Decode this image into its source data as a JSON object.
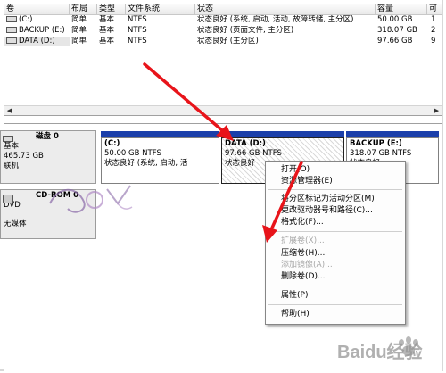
{
  "table": {
    "headers": [
      "卷",
      "布局",
      "类型",
      "文件系统",
      "状态",
      "容量",
      "可"
    ],
    "rows": [
      {
        "volume": "(C:)",
        "layout": "简单",
        "type": "基本",
        "fs": "NTFS",
        "status": "状态良好 (系统, 启动, 活动, 故障转储, 主分区)",
        "capacity": "50.00 GB",
        "free": "1"
      },
      {
        "volume": "BACKUP (E:)",
        "layout": "简单",
        "type": "基本",
        "fs": "NTFS",
        "status": "状态良好 (页面文件, 主分区)",
        "capacity": "318.07 GB",
        "free": "2"
      },
      {
        "volume": "DATA (D:)",
        "layout": "简单",
        "type": "基本",
        "fs": "NTFS",
        "status": "状态良好 (主分区)",
        "capacity": "97.66 GB",
        "free": "9"
      }
    ]
  },
  "disk0": {
    "title": "磁盘 0",
    "type": "基本",
    "size": "465.73 GB",
    "state": "联机"
  },
  "cdrom": {
    "title": "CD-ROM 0",
    "type": "DVD",
    "media": "无媒体"
  },
  "partitions": [
    {
      "name": "(C:)",
      "size": "50.00 GB NTFS",
      "status": "状态良好 (系统, 启动, 活"
    },
    {
      "name": "DATA (D:)",
      "size": "97.66 GB NTFS",
      "status": "状态良好"
    },
    {
      "name": "BACKUP (E:)",
      "size": "318.07 GB NTFS",
      "status": "状态良好"
    }
  ],
  "menu": {
    "open": "打开(O)",
    "explore": "资源管理器(E)",
    "mark_active": "将分区标记为活动分区(M)",
    "change_letter": "更改驱动器号和路径(C)...",
    "format": "格式化(F)...",
    "extend": "扩展卷(X)...",
    "shrink": "压缩卷(H)...",
    "add_mirror": "添加镜像(A)...",
    "delete": "删除卷(D)...",
    "properties": "属性(P)",
    "help": "帮助(H)"
  },
  "watermark": "Baidu经验",
  "colors": {
    "partition_strip": "#1b3faa",
    "arrow": "#e8141a"
  }
}
